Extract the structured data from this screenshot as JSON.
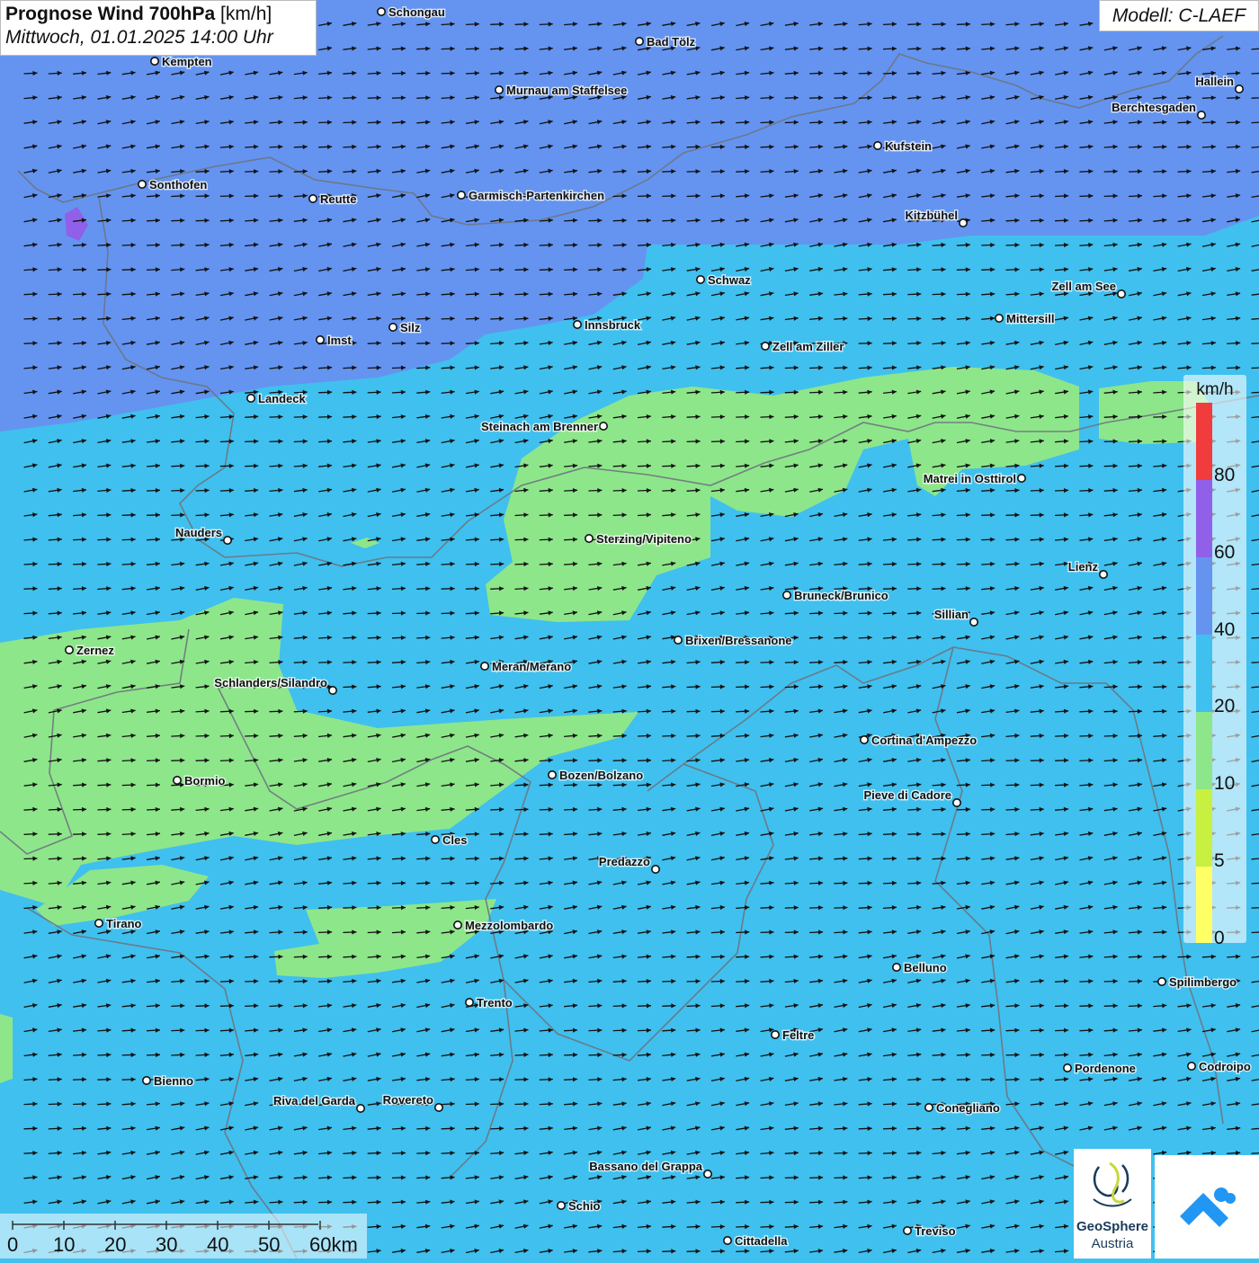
{
  "header": {
    "title_bold": "Prognose Wind 700hPa",
    "title_unit": "[km/h]",
    "datetime": "Mittwoch, 01.01.2025 14:00 Uhr"
  },
  "model_label": "Modell: C-LAEF",
  "legend": {
    "unit": "km/h",
    "ticks": [
      "0",
      "5",
      "10",
      "20",
      "40",
      "60",
      "80"
    ],
    "colors": [
      "#ffff66",
      "#c8f040",
      "#8ee68a",
      "#40c0ee",
      "#6494f0",
      "#9060e8",
      "#f03c3c"
    ]
  },
  "map_colors": {
    "calm": "#8ee68a",
    "moderate": "#40c0ee",
    "strong": "#6494f0",
    "very_strong": "#9060e8",
    "border": "#6e7480",
    "arrow": "#111111"
  },
  "cities": [
    {
      "name": "Schongau",
      "lon": 424,
      "lat": 13
    },
    {
      "name": "Bad Tölz",
      "lon": 711,
      "lat": 46
    },
    {
      "name": "Kempten",
      "lon": 172,
      "lat": 68
    },
    {
      "name": "Murnau am Staffelsee",
      "lon": 555,
      "lat": 100
    },
    {
      "name": "Hallein",
      "lon": 1378,
      "lat": 99
    },
    {
      "name": "Berchtesgaden",
      "lon": 1336,
      "lat": 128
    },
    {
      "name": "Kufstein",
      "lon": 976,
      "lat": 162
    },
    {
      "name": "Sonthofen",
      "lon": 158,
      "lat": 205
    },
    {
      "name": "Reutte",
      "lon": 348,
      "lat": 221
    },
    {
      "name": "Garmisch-Partenkirchen",
      "lon": 513,
      "lat": 217
    },
    {
      "name": "Kitzbühel",
      "lon": 1071,
      "lat": 248
    },
    {
      "name": "Schwaz",
      "lon": 779,
      "lat": 311
    },
    {
      "name": "Zell am See",
      "lon": 1247,
      "lat": 327
    },
    {
      "name": "Innsbruck",
      "lon": 642,
      "lat": 361
    },
    {
      "name": "Mittersill",
      "lon": 1111,
      "lat": 354
    },
    {
      "name": "Imst",
      "lon": 356,
      "lat": 378
    },
    {
      "name": "Silz",
      "lon": 437,
      "lat": 364
    },
    {
      "name": "Zell am Ziller",
      "lon": 851,
      "lat": 385
    },
    {
      "name": "Landeck",
      "lon": 279,
      "lat": 443
    },
    {
      "name": "Steinach am Brenner",
      "lon": 671,
      "lat": 474
    },
    {
      "name": "Matrei in Osttirol",
      "lon": 1136,
      "lat": 532
    },
    {
      "name": "Nauders",
      "lon": 253,
      "lat": 601
    },
    {
      "name": "Sterzing/Vipiteno",
      "lon": 655,
      "lat": 599
    },
    {
      "name": "Lienz",
      "lon": 1227,
      "lat": 639
    },
    {
      "name": "Bruneck/Brunico",
      "lon": 875,
      "lat": 662
    },
    {
      "name": "Sillian",
      "lon": 1083,
      "lat": 692
    },
    {
      "name": "Brixen/Bressanone",
      "lon": 754,
      "lat": 712
    },
    {
      "name": "Zernez",
      "lon": 77,
      "lat": 723
    },
    {
      "name": "Meran/Merano",
      "lon": 539,
      "lat": 741
    },
    {
      "name": "Schlanders/Silandro",
      "lon": 370,
      "lat": 768
    },
    {
      "name": "Cortina d'Ampezzo",
      "lon": 961,
      "lat": 823
    },
    {
      "name": "Bozen/Bolzano",
      "lon": 614,
      "lat": 862
    },
    {
      "name": "Bormio",
      "lon": 197,
      "lat": 868
    },
    {
      "name": "Pieve di Cadore",
      "lon": 1064,
      "lat": 893
    },
    {
      "name": "Cles",
      "lon": 484,
      "lat": 934
    },
    {
      "name": "Predazzo",
      "lon": 729,
      "lat": 967
    },
    {
      "name": "Tirano",
      "lon": 110,
      "lat": 1027
    },
    {
      "name": "Mezzolombardo",
      "lon": 509,
      "lat": 1029
    },
    {
      "name": "Belluno",
      "lon": 997,
      "lat": 1076
    },
    {
      "name": "Spilimbergo",
      "lon": 1292,
      "lat": 1092
    },
    {
      "name": "Trento",
      "lon": 522,
      "lat": 1115
    },
    {
      "name": "Feltre",
      "lon": 862,
      "lat": 1151
    },
    {
      "name": "Pordenone",
      "lon": 1187,
      "lat": 1188
    },
    {
      "name": "Codroipo",
      "lon": 1325,
      "lat": 1186
    },
    {
      "name": "Bienno",
      "lon": 163,
      "lat": 1202
    },
    {
      "name": "Riva del Garda",
      "lon": 401,
      "lat": 1233
    },
    {
      "name": "Rovereto",
      "lon": 488,
      "lat": 1232
    },
    {
      "name": "Conegliano",
      "lon": 1033,
      "lat": 1232
    },
    {
      "name": "Bassano del Grappa",
      "lon": 787,
      "lat": 1306
    },
    {
      "name": "Schio",
      "lon": 624,
      "lat": 1341
    },
    {
      "name": "Treviso",
      "lon": 1009,
      "lat": 1369
    },
    {
      "name": "Cittadella",
      "lon": 809,
      "lat": 1380
    }
  ],
  "scale_bar": {
    "ticks": [
      "0",
      "10",
      "20",
      "30",
      "40",
      "50",
      "60km"
    ]
  },
  "logos": {
    "geosphere_name": "GeoSphere",
    "geosphere_sub": "Austria"
  }
}
